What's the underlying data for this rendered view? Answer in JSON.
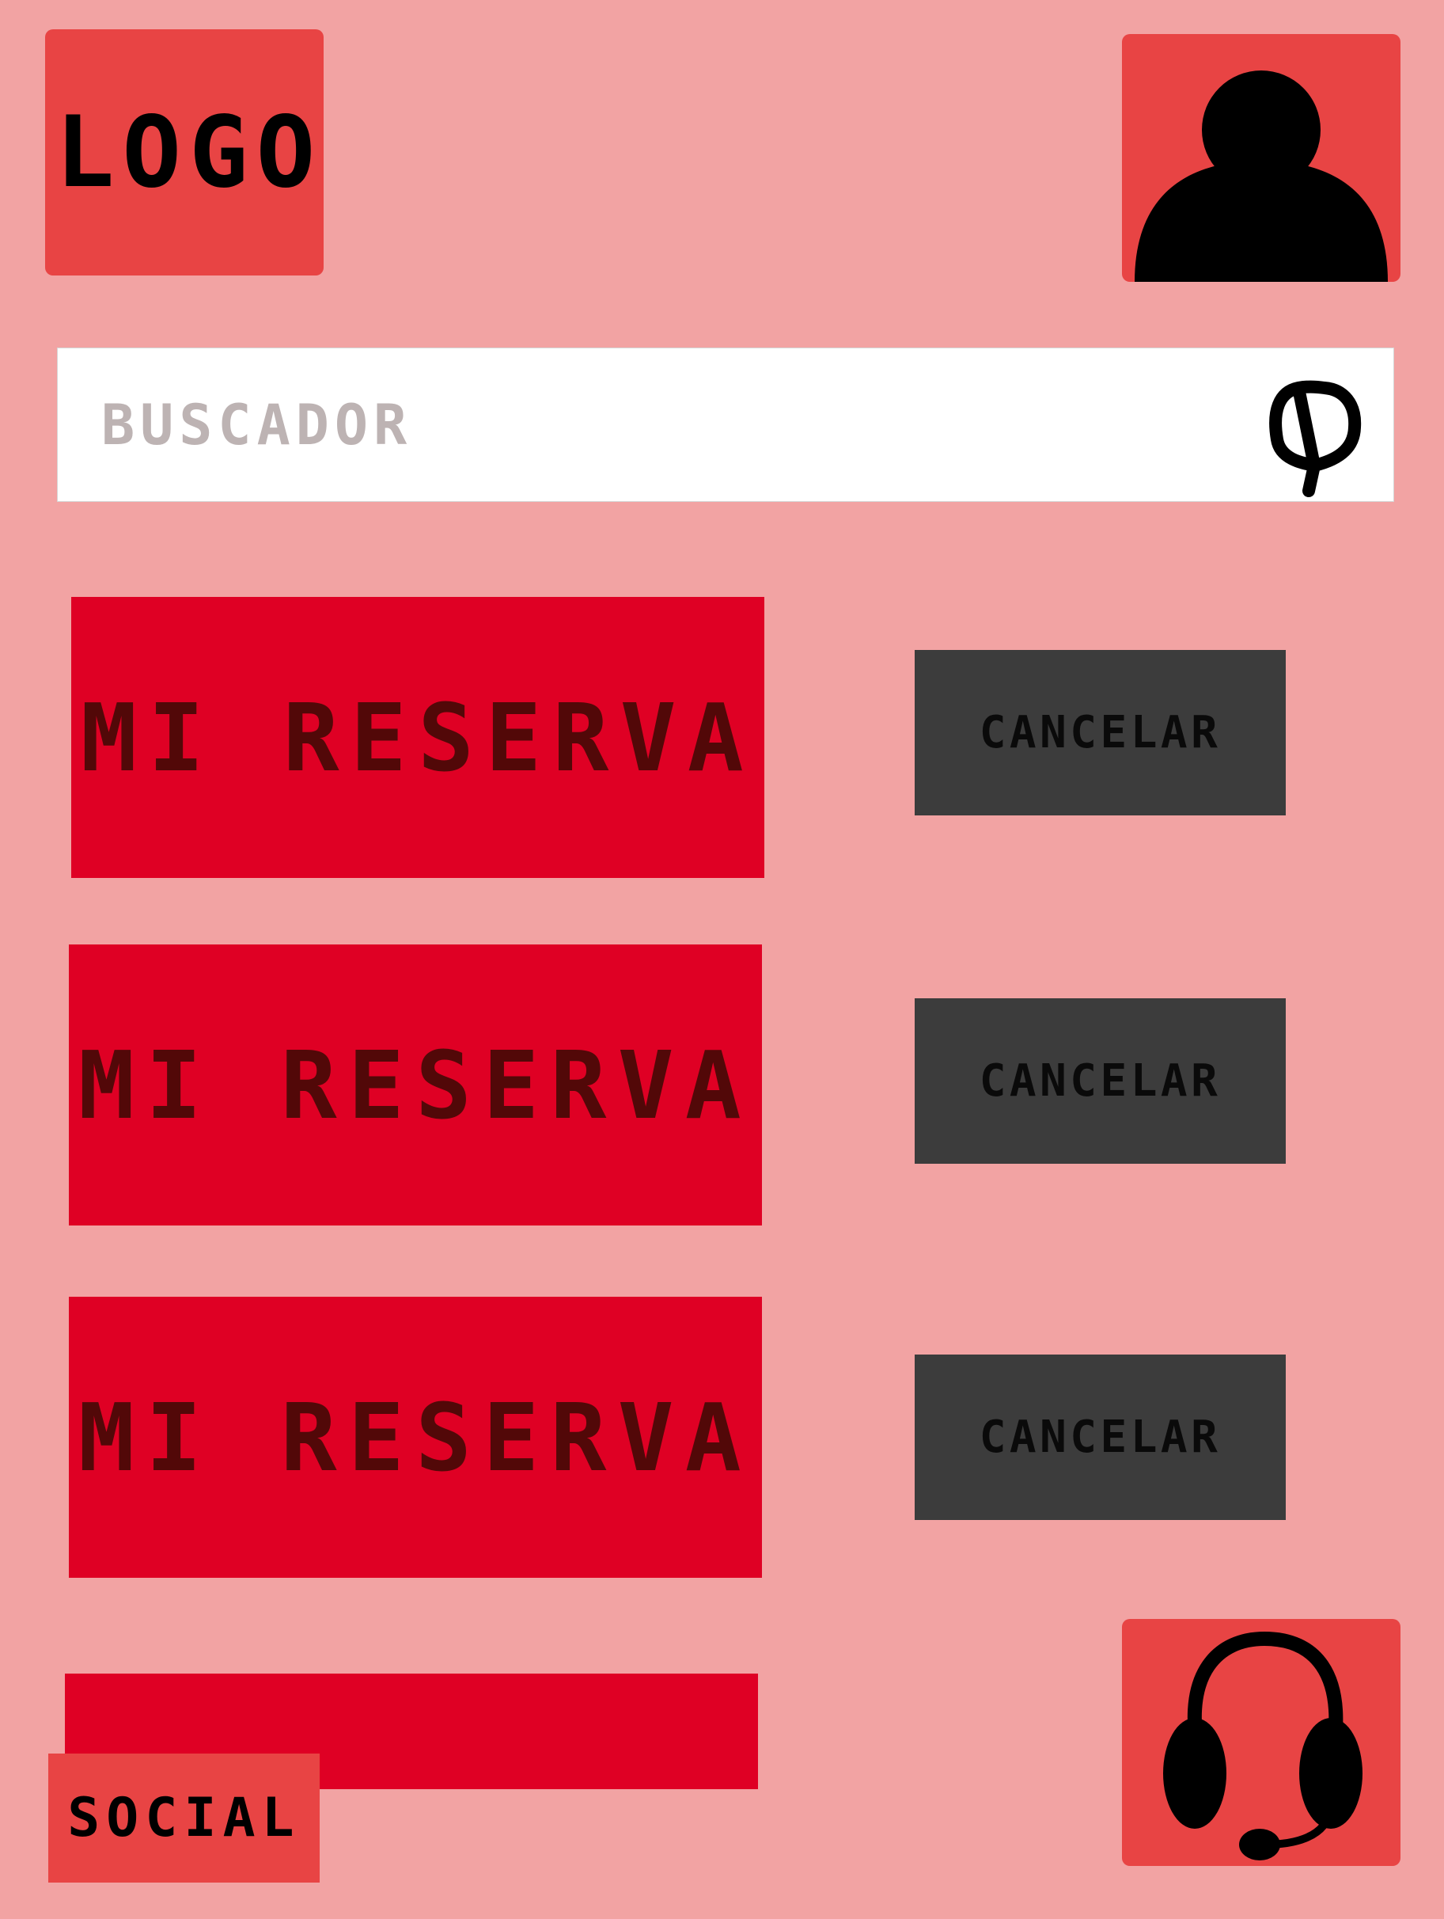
{
  "header": {
    "logo_text": "LOGO",
    "avatar_icon": "user-icon"
  },
  "search": {
    "placeholder": "BUSCADOR",
    "icon": "search-icon"
  },
  "reservations": [
    {
      "label": "MI RESERVA",
      "cancel_label": "CANCELAR"
    },
    {
      "label": "MI RESERVA",
      "cancel_label": "CANCELAR"
    },
    {
      "label": "MI RESERVA",
      "cancel_label": "CANCELAR"
    }
  ],
  "footer": {
    "social_label": "SOCIAL",
    "support_icon": "headset-icon"
  },
  "colors": {
    "background": "#f2a3a3",
    "accent_red": "#e84444",
    "reservation_red": "#df0024",
    "reservation_text": "#520808",
    "cancel_button": "#3c3c3c"
  }
}
